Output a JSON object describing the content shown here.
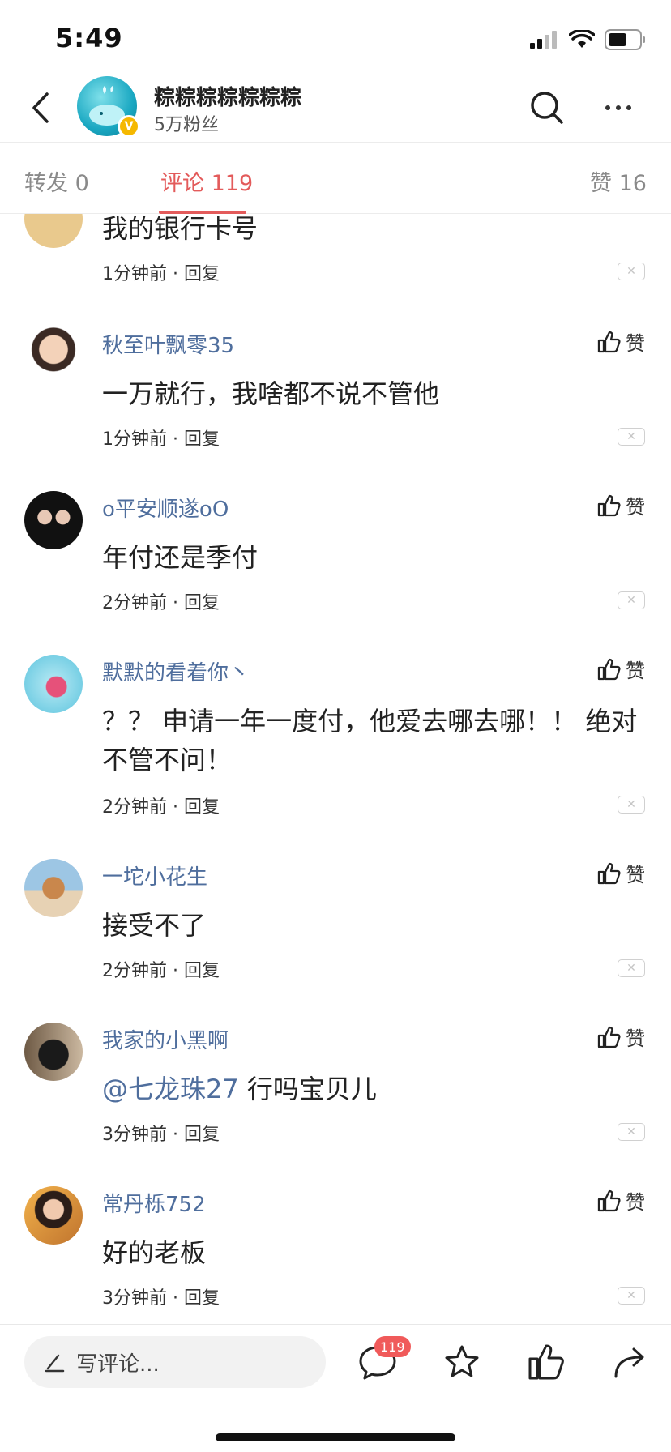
{
  "status_bar": {
    "time": "5:49"
  },
  "header": {
    "title": "粽粽粽粽粽粽粽",
    "subtitle": "5万粉丝"
  },
  "tabs": {
    "forward": "转发 0",
    "comments": "评论 119",
    "likes": "赞 16"
  },
  "comments": [
    {
      "user": "",
      "text": "我的银行卡号",
      "meta": "1分钟前 · 回复",
      "like_label": ""
    },
    {
      "user": "秋至叶飘零35",
      "text": "一万就行，我啥都不说不管他",
      "meta": "1分钟前 · 回复",
      "like_label": "赞"
    },
    {
      "user": "o平安顺遂oO",
      "text": "年付还是季付",
      "meta": "2分钟前 · 回复",
      "like_label": "赞"
    },
    {
      "user": "默默的看着你丶",
      "text": "？？ 申请一年一度付，他爱去哪去哪！！ 绝对不管不问！",
      "meta": "2分钟前 · 回复",
      "like_label": "赞"
    },
    {
      "user": "一坨小花生",
      "text": "接受不了",
      "meta": "2分钟前 · 回复",
      "like_label": "赞"
    },
    {
      "user": "我家的小黑啊",
      "mention": "@七龙珠27",
      "text": " 行吗宝贝儿",
      "meta": "3分钟前 · 回复",
      "like_label": "赞"
    },
    {
      "user": "常丹栎752",
      "text": "好的老板",
      "meta": "3分钟前 · 回复",
      "like_label": "赞"
    }
  ],
  "bottom_bar": {
    "input_placeholder": "写评论...",
    "comment_count_badge": "119"
  },
  "colors": {
    "accent": "#e35b5b",
    "username": "#4f6e9d",
    "badge": "#f05a5a"
  }
}
